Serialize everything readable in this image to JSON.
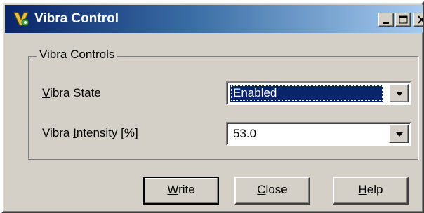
{
  "window": {
    "title": "Vibra Control",
    "app_icon": "app-icon",
    "controls": {
      "minimize": "minimize-icon",
      "maximize": "maximize-icon",
      "close": "close-icon"
    }
  },
  "group": {
    "label": "Vibra Controls",
    "fields": {
      "state": {
        "label_before": "",
        "label_accel": "V",
        "label_after": "ibra State",
        "value": "Enabled"
      },
      "intensity": {
        "label_before": "Vibra ",
        "label_accel": "I",
        "label_after": "ntensity [%]",
        "value": "53.0"
      }
    }
  },
  "buttons": {
    "write": {
      "accel": "W",
      "rest": "rite"
    },
    "close": {
      "accel": "C",
      "rest": "lose"
    },
    "help": {
      "accel": "H",
      "rest": "elp"
    }
  },
  "colors": {
    "title_bar_start": "#0a246a",
    "title_bar_end": "#a6caf0",
    "selection": "#0a246a",
    "face": "#d4d0c8"
  }
}
